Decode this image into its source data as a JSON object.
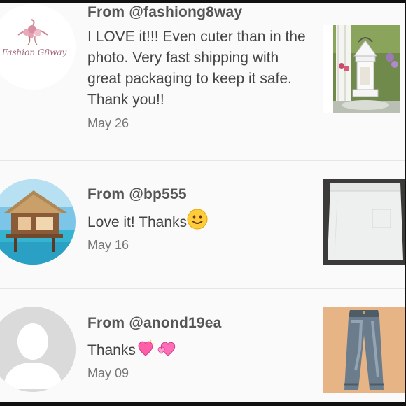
{
  "reviews": [
    {
      "from": "From @fashiong8way",
      "message": "I LOVE it!!! Even cuter than in the photo. Very fast shipping with great packaging to keep it safe. Thank you!!",
      "date": "May 26",
      "avatar_logo_text": "Fashion G8way",
      "avatar_icon": "hanger-logo-icon",
      "product_icon": "lantern-photo"
    },
    {
      "from": "From @bp555",
      "message": "Love it! Thanks",
      "emoji": "slightly-smiling-face",
      "date": "May 16",
      "avatar_icon": "beach-hut-photo",
      "product_icon": "white-skirt-photo"
    },
    {
      "from": "From @anond19ea",
      "message": "Thanks",
      "emoji": "two-hearts",
      "date": "May 09",
      "avatar_icon": "default-profile-icon",
      "product_icon": "jeans-photo"
    }
  ],
  "colors": {
    "background": "#fafafa",
    "text": "#444444",
    "date": "#777777",
    "divider": "#e6e6e6"
  }
}
